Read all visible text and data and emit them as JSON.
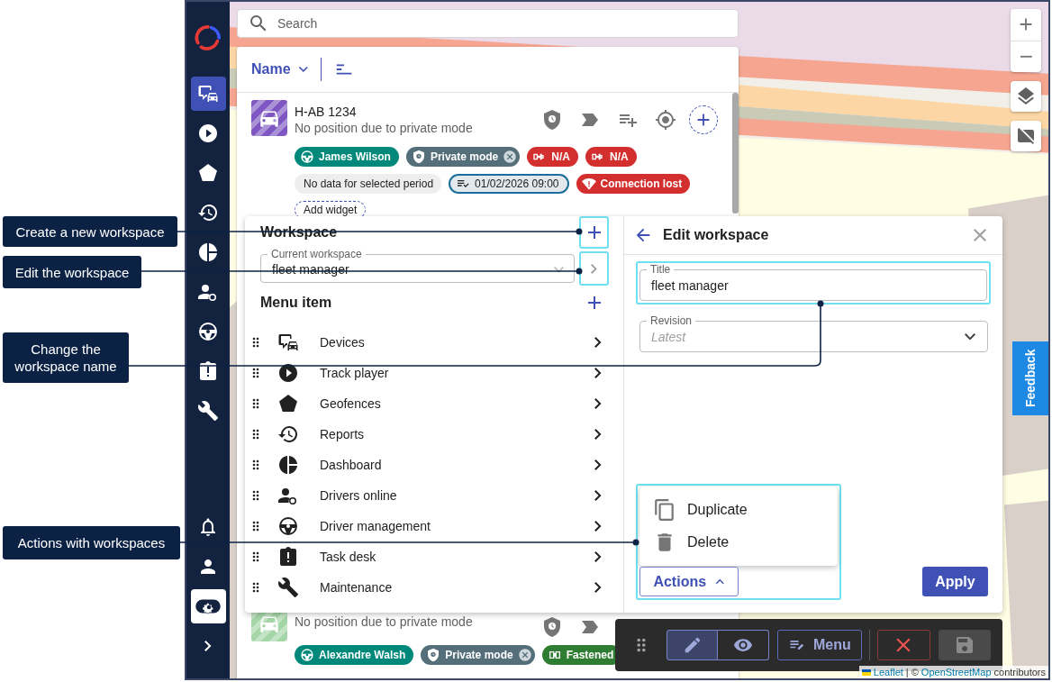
{
  "callouts": [
    {
      "text": "Create a new workspace"
    },
    {
      "text": "Edit the workspace"
    },
    {
      "text": "Change the workspace name"
    },
    {
      "text": "Actions with workspaces"
    }
  ],
  "sidebar": {
    "items": [
      {
        "selected": true
      },
      {
        "selected": false
      },
      {
        "selected": false
      },
      {
        "selected": false
      },
      {
        "selected": false
      },
      {
        "selected": false
      },
      {
        "selected": false
      },
      {
        "selected": false
      },
      {
        "selected": false
      }
    ],
    "bottom_items": [
      {
        "selected": false
      },
      {
        "selected": false
      },
      {
        "selected": true
      }
    ]
  },
  "search": {
    "placeholder": "Search"
  },
  "device_list": {
    "sort_label": "Name",
    "devices": [
      {
        "title": "H-AB 1234",
        "subtitle": "No position due to private mode",
        "color": "#7e57c2",
        "chip_rows": [
          [
            {
              "kind": "driver",
              "label": "James Wilson"
            },
            {
              "kind": "private",
              "label": "Private mode"
            },
            {
              "kind": "alert",
              "label": "N/A"
            },
            {
              "kind": "alert",
              "label": "N/A"
            }
          ],
          [
            {
              "kind": "plain",
              "label": "No data for selected period"
            },
            {
              "kind": "time",
              "label": "01/02/2026 09:00"
            },
            {
              "kind": "lost",
              "label": "Connection lost"
            }
          ],
          [
            {
              "kind": "add",
              "label": "Add widget"
            }
          ]
        ]
      },
      {
        "subtitle": "No position due to private mode",
        "color": "#a5d6a7",
        "chip_rows": [
          [
            {
              "kind": "driver",
              "label": "Alexandre Walsh"
            },
            {
              "kind": "private",
              "label": "Private mode"
            },
            {
              "kind": "fastened",
              "label": "Fastened"
            }
          ]
        ]
      }
    ]
  },
  "workspace_panel": {
    "title": "Workspace",
    "current_workspace": {
      "label": "Current workspace",
      "value": "fleet manager"
    },
    "menu_title": "Menu item",
    "menu_items": [
      {
        "label": "Devices"
      },
      {
        "label": "Track player"
      },
      {
        "label": "Geofences"
      },
      {
        "label": "Reports"
      },
      {
        "label": "Dashboard"
      },
      {
        "label": "Drivers online"
      },
      {
        "label": "Driver management"
      },
      {
        "label": "Task desk"
      },
      {
        "label": "Maintenance"
      }
    ]
  },
  "edit_panel": {
    "title": "Edit workspace",
    "title_field": {
      "label": "Title",
      "value": "fleet manager"
    },
    "revision_field": {
      "label": "Revision",
      "placeholder": "Latest"
    },
    "actions": {
      "label": "Actions",
      "expanded": true,
      "items": [
        {
          "label": "Duplicate"
        },
        {
          "label": "Delete"
        }
      ]
    },
    "apply_label": "Apply"
  },
  "map_controls": {
    "feedback_label": "Feedback"
  },
  "toolbar": {
    "modes": [
      {
        "selected": true
      },
      {
        "selected": false
      }
    ],
    "menu_label": "Menu",
    "save_disabled": true
  },
  "attribution": {
    "parts": [
      {
        "kind": "link",
        "text": "Leaflet"
      },
      {
        "kind": "text",
        "text": "| ©"
      },
      {
        "kind": "link",
        "text": "OpenStreetMap"
      },
      {
        "kind": "text",
        "text": "contributors"
      }
    ]
  }
}
